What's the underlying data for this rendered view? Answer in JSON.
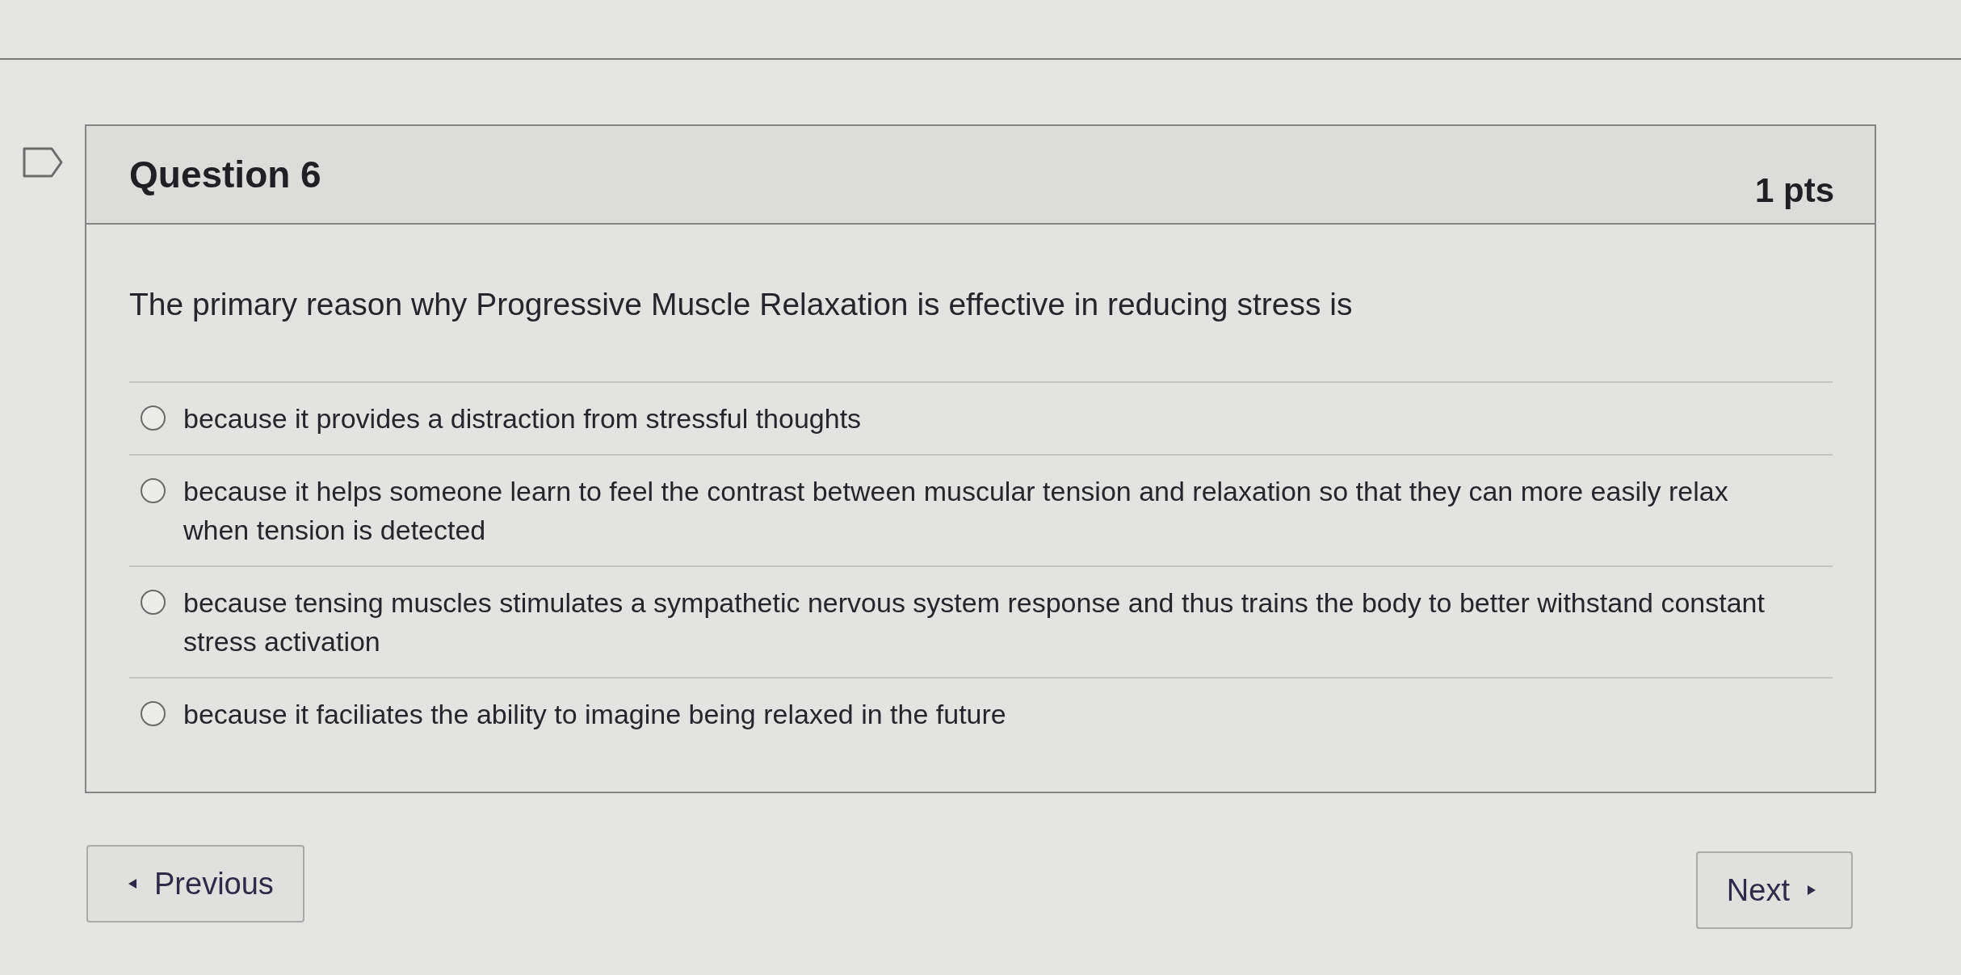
{
  "question": {
    "flagged": false,
    "title": "Question 6",
    "points": "1 pts",
    "text": "The primary reason why Progressive Muscle Relaxation is effective in reducing stress is",
    "options": [
      {
        "text": "because it provides a distraction from stressful thoughts",
        "selected": false
      },
      {
        "text": "because it helps someone learn to feel the contrast between muscular tension and relaxation so that they can more easily relax when tension is detected",
        "selected": false
      },
      {
        "text": "because tensing muscles stimulates a sympathetic nervous system response and thus trains the body to better withstand constant stress activation",
        "selected": false
      },
      {
        "text": "because it faciliates the ability to imagine being relaxed in the future",
        "selected": false
      }
    ]
  },
  "navigation": {
    "previous": "Previous",
    "next": "Next"
  }
}
